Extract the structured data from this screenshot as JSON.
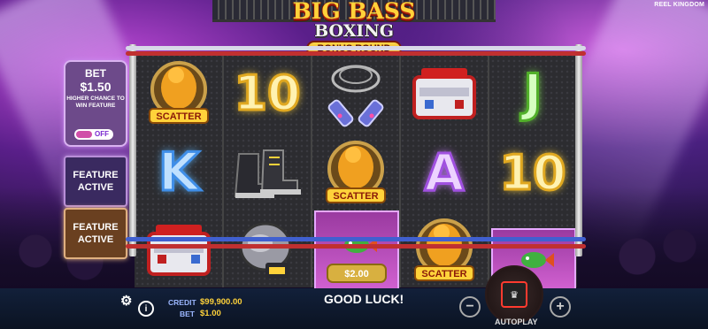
{
  "logo": {
    "line1": "BIG BASS",
    "line2": "BOXING",
    "badge": "BONUS ROUND"
  },
  "brand": "REEL KINGDOM",
  "left_panel": {
    "bet_title": "BET",
    "bet_amount": "$1.50",
    "bet_note": "HIGHER CHANCE TO WIN FEATURE",
    "toggle_state": "OFF",
    "feature_1": "FEATURE ACTIVE",
    "feature_2": "FEATURE ACTIVE"
  },
  "reels": [
    [
      "SCATTER",
      "K",
      "tackle-box"
    ],
    [
      "10",
      "boots",
      "glove"
    ],
    [
      "rope",
      "SCATTER",
      "fish-money"
    ],
    [
      "tackle-box",
      "A",
      "SCATTER"
    ],
    [
      "J",
      "10",
      "fish-money-partial"
    ]
  ],
  "symbol_text": {
    "scatter": "SCATTER",
    "ten": "10",
    "k": "K",
    "a": "A",
    "j": "J",
    "money": "$2.00"
  },
  "bottom_bar": {
    "credit_label": "CREDIT",
    "credit_value": "$99,900.00",
    "bet_label": "BET",
    "bet_value": "$1.00",
    "message": "GOOD LUCK!",
    "autoplay": "AUTOPLAY",
    "minus": "−",
    "plus": "+",
    "info": "i"
  },
  "colors": {
    "neon_gold": "#ffd23a",
    "neon_blue": "#5fb8ff",
    "neon_purple": "#c77bff",
    "neon_green": "#7be04a"
  }
}
